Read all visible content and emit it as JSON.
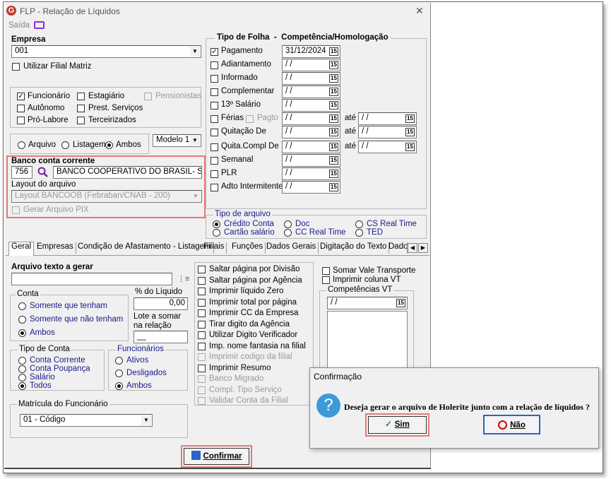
{
  "window": {
    "title": "FLP - Relação de Líquidos",
    "close": "✕",
    "saida": "Saída"
  },
  "empresa": {
    "label": "Empresa",
    "value": "001",
    "filial_matriz": "Utilizar Filial Matriz"
  },
  "tipos": {
    "funcionario": "Funcionário",
    "estagiario": "Estagiário",
    "pensionistas": "Pensionistas",
    "autonomo": "Autônomo",
    "prest": "Prest. Serviços",
    "prolabore": "Pró-Labore",
    "terceirizados": "Terceirizados"
  },
  "saida_tipo": {
    "arquivo": "Arquivo",
    "listagem": "Listagem",
    "ambos": "Ambos",
    "modelo": "Modelo 1"
  },
  "banco": {
    "label": "Banco conta corrente",
    "code": "756",
    "name": "BANCO COOPERATIVO DO BRASIL- SICOOB",
    "layout_label": "Layout do arquivo",
    "layout_value": "Layout BANCOOB (Febraban/CNAB - 200)",
    "pix": "Gerar Arquivo PIX"
  },
  "folha": {
    "header": "Tipo de Folha  -  Competência/Homologação",
    "ate": "até",
    "empty_date": "/ /",
    "rows": [
      {
        "label": "Pagamento",
        "date": "31/12/2024"
      },
      {
        "label": "Adiantamento",
        "date": "/ /"
      },
      {
        "label": "Informado",
        "date": "/ /"
      },
      {
        "label": "Complementar",
        "date": "/ /"
      },
      {
        "label": "13º Salário",
        "date": "/ /"
      },
      {
        "label": "Férias",
        "extra": "Pagto",
        "date": "/ /"
      },
      {
        "label": "Quitação De",
        "date": "/ /"
      },
      {
        "label": "Quita.Compl De",
        "date": "/ /"
      },
      {
        "label": "Semanal",
        "date": "/ /"
      },
      {
        "label": "PLR",
        "date": "/ /"
      },
      {
        "label": "Adto Intermitente",
        "date": "/ /"
      }
    ]
  },
  "tipo_arquivo": {
    "label": "Tipo de arquivo",
    "credito": "Crédito Conta",
    "cartao": "Cartão salário",
    "doc": "Doc",
    "ccrt": "CC Real Time",
    "csrt": "CS Real Time",
    "ted": "TED"
  },
  "tabs": [
    "Geral",
    "Empresas",
    "Condição de Afastamento - Listagem",
    "Filiais",
    "Funções",
    "Dados Gerais",
    "Digitação do Texto",
    "Dados"
  ],
  "geral": {
    "arquivo_label": "Arquivo texto a gerar",
    "conta_label": "Conta",
    "somente_tenham": "Somente que tenham",
    "somente_nao": "Somente que não tenham",
    "ambos": "Ambos",
    "pct_label": "% do Líquido",
    "pct_value": "0,00",
    "lote_label1": "Lote a somar",
    "lote_label2": "na relação",
    "lote_value": "__",
    "tipo_conta_label": "Tipo de Conta",
    "corrente": "Conta Corrente",
    "poupanca": "Conta Poupança",
    "salario": "Salário",
    "todos": "Todos",
    "func_label": "Funcionários",
    "ativos": "Ativos",
    "desligados": "Desligados",
    "func_ambos": "Ambos",
    "matricula_label": "Matrícula do Funcionário",
    "matricula_value": "01 - Código",
    "options": [
      "Saltar página por Divisão",
      "Saltar página por Agência",
      "Imprimir líquido Zero",
      "Imprimir total por página",
      "Imprimir CC da Empresa",
      "Tirar digito da Agência",
      "Utilizar Digito Verificador",
      "Imp. nome fantasia na filial",
      "Imprimir codigo da filial",
      "Imprimir Resumo",
      "Banco Migrado",
      "Compl. Tipo Serviço",
      "Validar Conta da Filial"
    ],
    "vale": "Somar Vale Transporte",
    "coluna_vt": "Imprimir coluna VT",
    "comp_vt": "Competências VT"
  },
  "confirmar": "Confirmar",
  "dialog": {
    "title": "Confirmação",
    "message": "Deseja gerar o arquivo de Holerite junto com a relação de líquidos ?",
    "sim": "Sim",
    "nao": "Não"
  }
}
